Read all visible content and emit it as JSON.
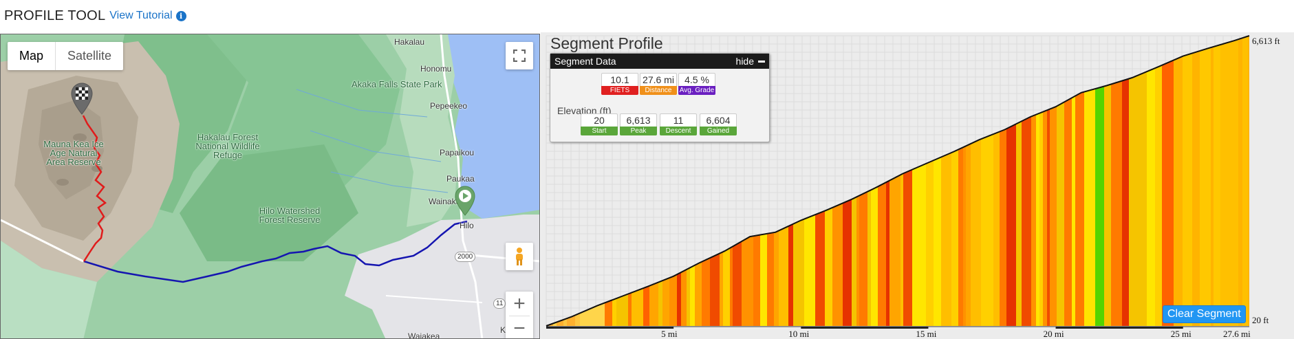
{
  "header": {
    "title": "PROFILE TOOL",
    "tutorial_link": "View Tutorial",
    "info_icon": "info-icon"
  },
  "map": {
    "type_options": [
      "Map",
      "Satellite"
    ],
    "selected_type": "Map",
    "labels": {
      "hakalau": "Hakalau",
      "honomu": "Honomu",
      "akaka": "Akaka Falls State Park",
      "pepeekeo": "Pepeekeo",
      "papaikou": "Papaikou",
      "paukaa": "Paukaa",
      "wainaku": "Wainaku",
      "hilo": "Hilo",
      "hakalau_forest": "Hakalau Forest National Wildlife Refuge",
      "mauna_kea": "Mauna Kea Ice Age Natural Area Reserve",
      "hilo_watershed": "Hilo Watershed Forest Reserve",
      "waiakea": "Waiakea",
      "route_2000": "2000",
      "route_11": "11",
      "k": "K"
    },
    "controls": {
      "fullscreen": "fullscreen-icon",
      "pegman": "pegman-icon",
      "zoom_in": "+",
      "zoom_out": "−"
    },
    "colors": {
      "climb_route": "#e01b1b",
      "flat_route": "#1515b0"
    }
  },
  "profile": {
    "title": "Segment Profile",
    "segment_data": {
      "header": "Segment Data",
      "hide_label": "hide",
      "fiets": {
        "value": "10.1",
        "label": "FIETS",
        "color": "#e02020"
      },
      "distance": {
        "value": "27.6 mi",
        "label": "Distance",
        "color": "#f0901a"
      },
      "avg_grade": {
        "value": "4.5 %",
        "label": "Avg. Grade",
        "color": "#6a1fc0"
      },
      "elevation_title": "Elevation (ft)",
      "start": {
        "value": "20",
        "label": "Start"
      },
      "peak": {
        "value": "6,613",
        "label": "Peak"
      },
      "descent": {
        "value": "11",
        "label": "Descent"
      },
      "gained": {
        "value": "6,604",
        "label": "Gained"
      },
      "elev_color": "#5aa63a"
    },
    "clear_button": "Clear Segment",
    "y_top_label": "6,613 ft",
    "y_bottom_label": "20 ft",
    "x_ticks": [
      "5 mi",
      "10 mi",
      "15 mi",
      "20 mi",
      "25 mi",
      "27.6 mi"
    ]
  },
  "chart_data": {
    "type": "area",
    "x": [
      0,
      1,
      2,
      3,
      4,
      5,
      6,
      7,
      8,
      9,
      10,
      11,
      12,
      13,
      14,
      15,
      16,
      17,
      18,
      19,
      20,
      21,
      22,
      23,
      24,
      25,
      26,
      27,
      27.6
    ],
    "y": [
      20,
      230,
      480,
      700,
      920,
      1150,
      1450,
      1720,
      2050,
      2150,
      2420,
      2650,
      2900,
      3180,
      3480,
      3730,
      3980,
      4250,
      4480,
      4770,
      5000,
      5320,
      5480,
      5660,
      5900,
      6150,
      6330,
      6500,
      6613
    ],
    "xunit": "mi",
    "yunit": "ft",
    "xlim": [
      0,
      27.6
    ],
    "ylim": [
      20,
      6613
    ],
    "fill": "colored by grade",
    "grid": true
  }
}
